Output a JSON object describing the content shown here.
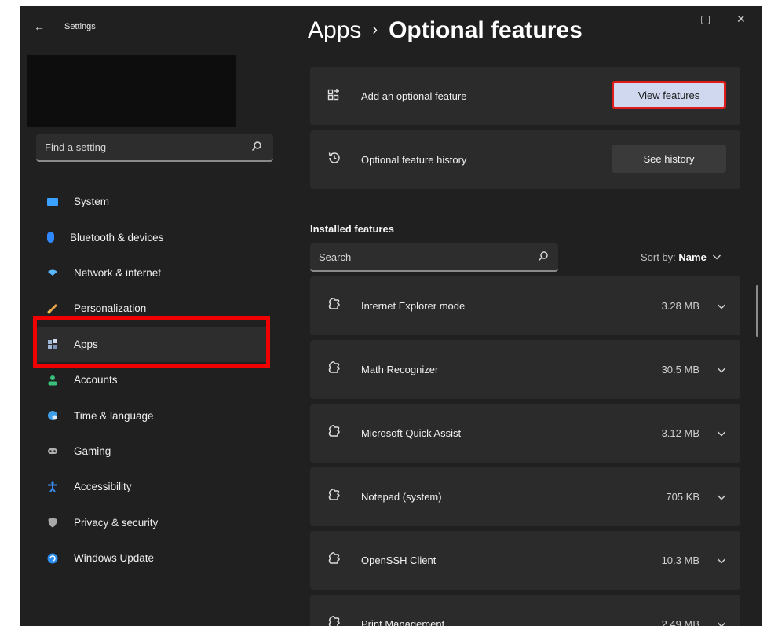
{
  "app": {
    "title": "Settings"
  },
  "sidebar": {
    "search_placeholder": "Find a setting",
    "items": [
      {
        "label": "System",
        "icon": "system-icon",
        "color": "#3ca0ff"
      },
      {
        "label": "Bluetooth & devices",
        "icon": "bluetooth-icon",
        "color": "#2f88ff"
      },
      {
        "label": "Network & internet",
        "icon": "wifi-icon",
        "color": "#59b9ff"
      },
      {
        "label": "Personalization",
        "icon": "brush-icon",
        "color": "#e8a34a"
      },
      {
        "label": "Apps",
        "icon": "apps-icon",
        "color": "#9fb5d4"
      },
      {
        "label": "Accounts",
        "icon": "person-icon",
        "color": "#38c07a"
      },
      {
        "label": "Time & language",
        "icon": "globe-clock-icon",
        "color": "#3f9ee8"
      },
      {
        "label": "Gaming",
        "icon": "gamepad-icon",
        "color": "#b0b0b0"
      },
      {
        "label": "Accessibility",
        "icon": "accessibility-icon",
        "color": "#3a8ef0"
      },
      {
        "label": "Privacy & security",
        "icon": "shield-icon",
        "color": "#a8a8a8"
      },
      {
        "label": "Windows Update",
        "icon": "update-icon",
        "color": "#2c8ef0"
      }
    ],
    "selected_index": 4
  },
  "header": {
    "breadcrumb_parent": "Apps",
    "breadcrumb_separator": "›",
    "breadcrumb_current": "Optional features"
  },
  "window_controls": {
    "minimize": "–",
    "maximize": "▢",
    "close": "✕"
  },
  "cards": {
    "add": {
      "label": "Add an optional feature",
      "button": "View features"
    },
    "history": {
      "label": "Optional feature history",
      "button": "See history"
    }
  },
  "installed": {
    "title": "Installed features",
    "search_placeholder": "Search",
    "sort_prefix": "Sort by:",
    "sort_value": "Name",
    "features": [
      {
        "name": "Internet Explorer mode",
        "size": "3.28 MB"
      },
      {
        "name": "Math Recognizer",
        "size": "30.5 MB"
      },
      {
        "name": "Microsoft Quick Assist",
        "size": "3.12 MB"
      },
      {
        "name": "Notepad (system)",
        "size": "705 KB"
      },
      {
        "name": "OpenSSH Client",
        "size": "10.3 MB"
      },
      {
        "name": "Print Management",
        "size": "2.49 MB"
      }
    ]
  },
  "colors": {
    "background": "#202020",
    "card": "#2b2b2b",
    "accent_button": "#cfd8ef",
    "highlight": "#f00000"
  }
}
